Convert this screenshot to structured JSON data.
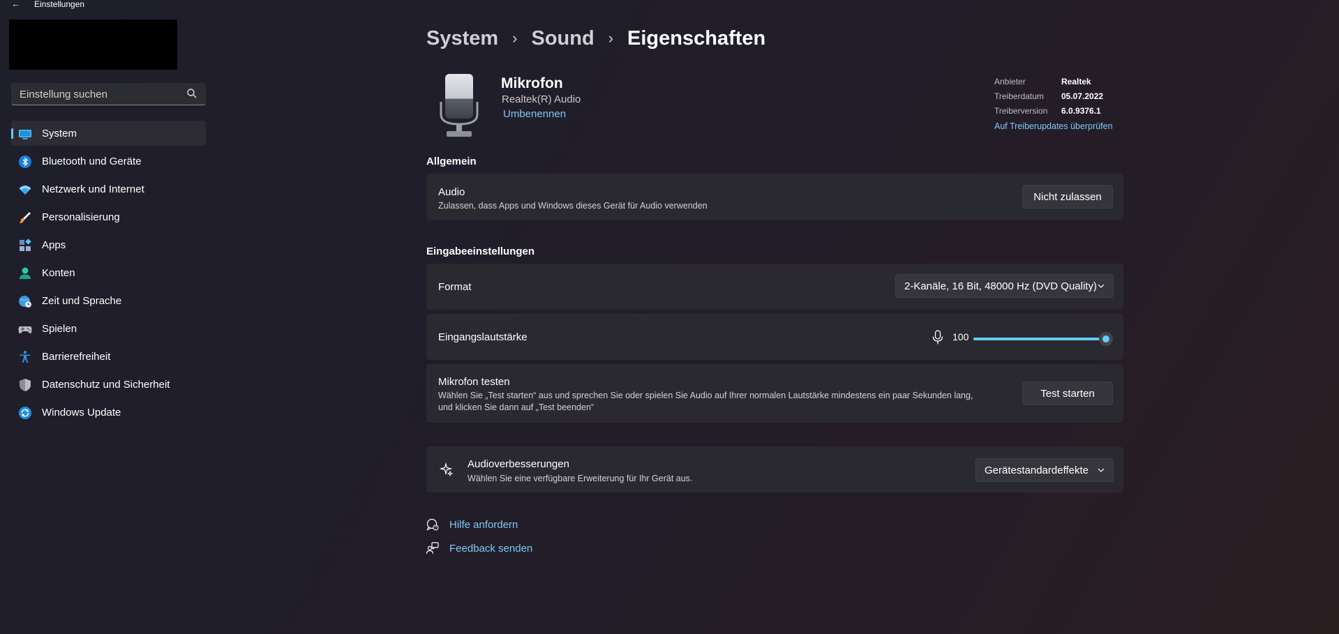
{
  "window": {
    "title": "Einstellungen"
  },
  "search": {
    "placeholder": "Einstellung suchen"
  },
  "sidebar": {
    "items": [
      {
        "label": "System",
        "icon": "system-icon"
      },
      {
        "label": "Bluetooth und Geräte",
        "icon": "bluetooth-icon"
      },
      {
        "label": "Netzwerk und Internet",
        "icon": "wifi-icon"
      },
      {
        "label": "Personalisierung",
        "icon": "brush-icon"
      },
      {
        "label": "Apps",
        "icon": "apps-icon"
      },
      {
        "label": "Konten",
        "icon": "account-icon"
      },
      {
        "label": "Zeit und Sprache",
        "icon": "globe-clock-icon"
      },
      {
        "label": "Spielen",
        "icon": "gamepad-icon"
      },
      {
        "label": "Barrierefreiheit",
        "icon": "accessibility-icon"
      },
      {
        "label": "Datenschutz und Sicherheit",
        "icon": "shield-icon"
      },
      {
        "label": "Windows Update",
        "icon": "update-icon"
      }
    ],
    "active_index": 0
  },
  "breadcrumb": {
    "level1": "System",
    "level2": "Sound",
    "current": "Eigenschaften"
  },
  "device": {
    "name": "Mikrofon",
    "driver_name": "Realtek(R) Audio",
    "rename_label": "Umbenennen",
    "info": {
      "vendor_key": "Anbieter",
      "vendor_val": "Realtek",
      "date_key": "Treiberdatum",
      "date_val": "05.07.2022",
      "version_key": "Treiberversion",
      "version_val": "6.0.9376.1",
      "update_link": "Auf Treiberupdates überprüfen"
    }
  },
  "general": {
    "section_title": "Allgemein",
    "audio_title": "Audio",
    "audio_desc": "Zulassen, dass Apps und Windows dieses Gerät für Audio verwenden",
    "audio_button": "Nicht zulassen"
  },
  "input": {
    "section_title": "Eingabeeinstellungen",
    "format_label": "Format",
    "format_value": "2-Kanäle, 16 Bit, 48000 Hz (DVD Quality)",
    "volume_label": "Eingangslautstärke",
    "volume_value": "100",
    "volume_level": 100,
    "test_title": "Mikrofon testen",
    "test_desc_line1": "Wählen Sie „Test starten“ aus und sprechen Sie oder spielen Sie Audio auf Ihrer normalen Lautstärke mindestens ein paar Sekunden lang,",
    "test_desc_line2": "und klicken Sie dann auf „Test beenden“",
    "test_button": "Test starten"
  },
  "enhancements": {
    "title": "Audioverbesserungen",
    "desc": "Wählen Sie eine verfügbare Erweiterung für Ihr Gerät aus.",
    "value": "Gerätestandardeffekte"
  },
  "help": {
    "get_help": "Hilfe anfordern",
    "feedback": "Feedback senden"
  },
  "colors": {
    "accent": "#60cdff",
    "link": "#7fc9f2",
    "card": "#2b2930"
  }
}
